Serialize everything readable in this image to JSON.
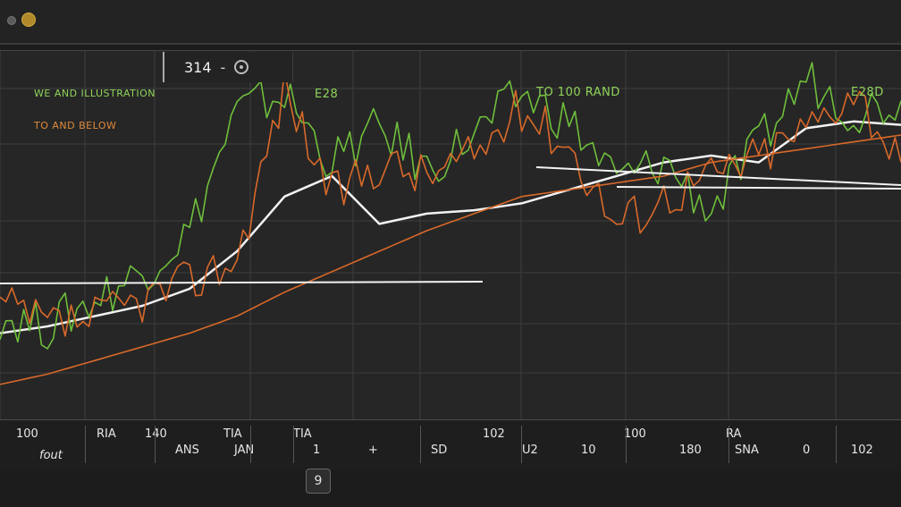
{
  "window": {
    "controls": [
      "window-control",
      "window-control"
    ]
  },
  "header": {
    "symbol": "314",
    "separator": "-",
    "search_icon": "search-icon"
  },
  "legend": [
    {
      "label": "WE AND ILLUSTRATION",
      "color": "#8fd45a"
    },
    {
      "label": "TO AND BELOW",
      "color": "#e08a3a"
    }
  ],
  "chart_labels": [
    {
      "text": "E28",
      "color": "#8fd45a"
    },
    {
      "text": "TO 100 RAND",
      "color": "#8fd45a"
    },
    {
      "text": "E28D",
      "color": "#8fd45a"
    }
  ],
  "xaxis": {
    "top_ticks": [
      "100",
      "RIA",
      "140",
      "TIA",
      "TIA",
      "",
      "102",
      "",
      "",
      "100",
      "",
      "",
      "RA",
      "",
      ""
    ],
    "bottom_ticks": [
      "fout",
      "",
      "ANS",
      "JAN",
      "1",
      "+",
      "SD",
      "U2",
      "10",
      "",
      "180",
      "SNA",
      "0",
      "102"
    ]
  },
  "pager": {
    "label": "9"
  },
  "colors": {
    "green": "#6fbf3c",
    "orange": "#d9692a",
    "white": "#f2f2f2",
    "grid": "#3d3d3d",
    "background": "#262626"
  },
  "chart_data": {
    "type": "line",
    "title": "",
    "xlabel": "",
    "ylabel": "",
    "series": [
      {
        "name": "",
        "color": "#f2f2f2",
        "values": [
          20,
          22,
          25,
          28,
          33,
          44,
          60,
          66,
          52,
          55,
          56,
          58,
          62,
          66,
          70,
          72,
          70,
          80,
          82,
          81
        ]
      },
      {
        "name": "",
        "color": "#6fbf3c",
        "values": [
          25,
          22,
          30,
          38,
          50,
          85,
          90,
          70,
          80,
          68,
          78,
          90,
          82,
          65,
          70,
          56,
          75,
          95,
          85,
          88
        ]
      },
      {
        "name": "",
        "color": "#d9692a",
        "values": [
          28,
          22,
          24,
          30,
          35,
          42,
          92,
          60,
          70,
          66,
          72,
          86,
          75,
          52,
          60,
          66,
          72,
          80,
          92,
          70
        ]
      },
      {
        "name": "",
        "color": "#d9692a",
        "values": [
          5,
          8,
          12,
          16,
          20,
          25,
          32,
          38,
          44,
          50,
          55,
          60,
          62,
          64,
          66,
          70,
          72,
          74,
          76,
          78
        ]
      }
    ],
    "ylim": [
      0,
      100
    ],
    "grid": true,
    "legend": "top-left"
  }
}
